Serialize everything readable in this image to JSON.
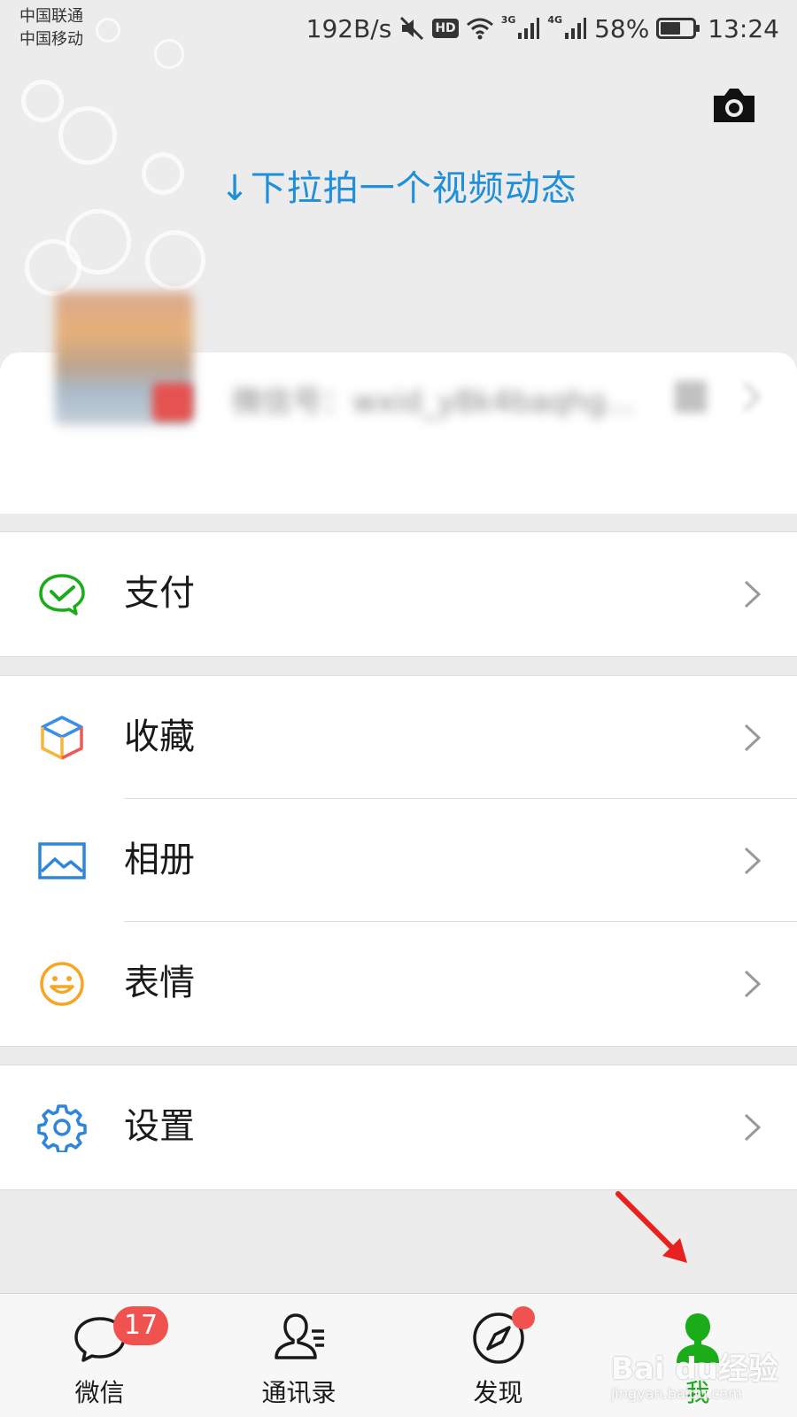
{
  "status_bar": {
    "carrier_1": "中国联通",
    "carrier_2": "中国移动",
    "net_speed": "192B/s",
    "hd": "HD",
    "sig_3g": "3G",
    "sig_4g": "4G",
    "battery": "58%",
    "time": "13:24"
  },
  "header": {
    "pull_hint": "↓下拉拍一个视频动态",
    "camera_icon": "camera-icon"
  },
  "profile": {
    "wechat_id": "微信号：wxid_y8k4baqhg..."
  },
  "menu": {
    "pay": "支付",
    "favorites": "收藏",
    "album": "相册",
    "stickers": "表情",
    "settings": "设置"
  },
  "tabs": {
    "chats": "微信",
    "chats_badge": "17",
    "contacts": "通讯录",
    "discover": "发现",
    "me": "我"
  },
  "watermark": {
    "brand": "Bai du经验",
    "url": "jingyan.baidu.com"
  },
  "colors": {
    "accent_green": "#1aad19",
    "hint_blue": "#1e8fd8",
    "badge_red": "#f0524f",
    "arrow_red": "#e6211f"
  }
}
